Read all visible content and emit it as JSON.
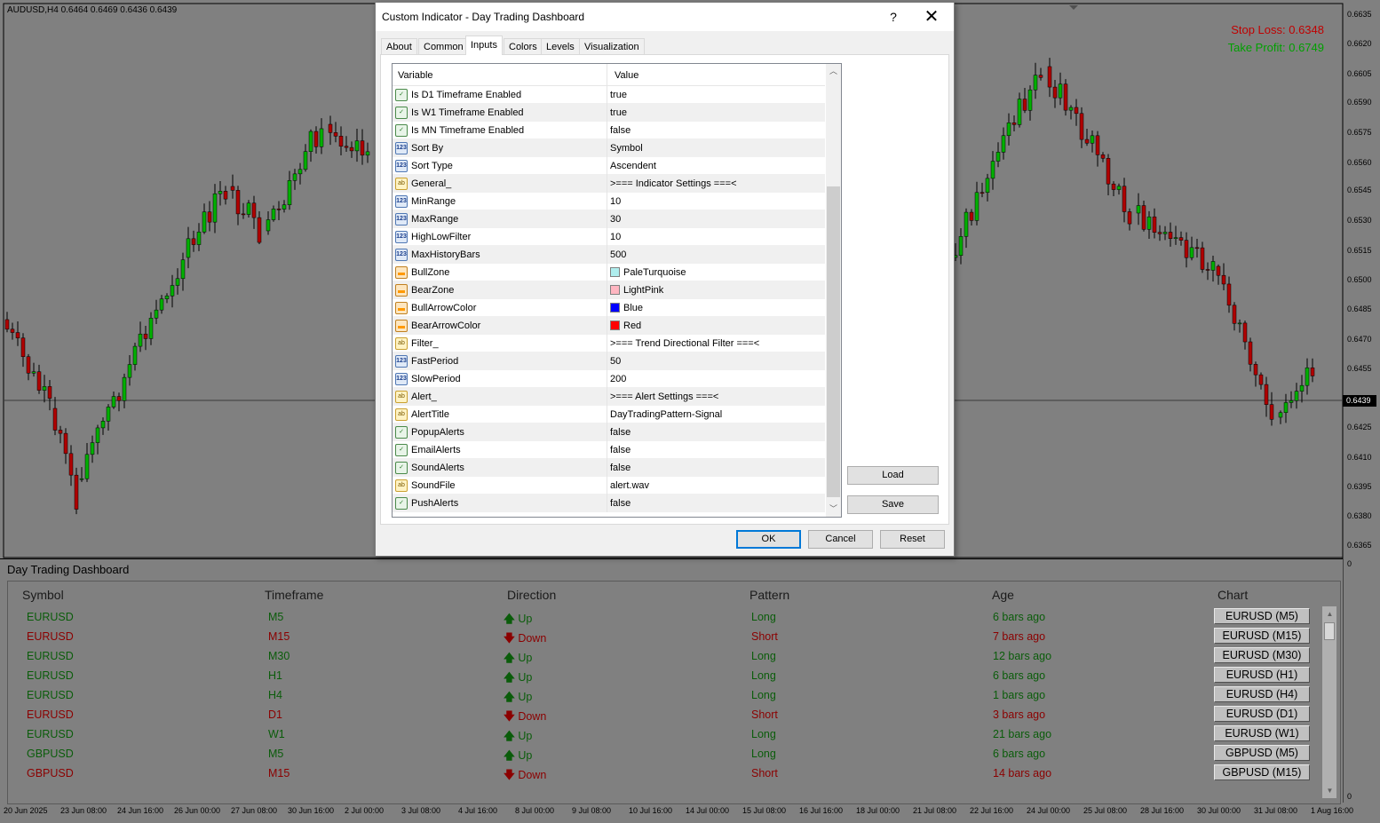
{
  "chart": {
    "symbol_header": "AUDUSD,H4  0.6464 0.6469 0.6436 0.6439",
    "stop_loss": "Stop Loss: 0.6348",
    "take_profit": "Take Profit: 0.6749",
    "current_price": "0.6439",
    "price_axis": [
      "0.6635",
      "0.6620",
      "0.6605",
      "0.6590",
      "0.6575",
      "0.6560",
      "0.6545",
      "0.6530",
      "0.6515",
      "0.6500",
      "0.6485",
      "0.6470",
      "0.6455",
      "0.6425",
      "0.6410",
      "0.6395",
      "0.6380",
      "0.6365",
      "0",
      "0"
    ],
    "time_axis": [
      "20 Jun 2025",
      "23 Jun 08:00",
      "24 Jun 16:00",
      "26 Jun 00:00",
      "27 Jun 08:00",
      "30 Jun 16:00",
      "2 Jul 00:00",
      "3 Jul 08:00",
      "4 Jul 16:00",
      "8 Jul 00:00",
      "9 Jul 08:00",
      "10 Jul 16:00",
      "14 Jul 00:00",
      "15 Jul 08:00",
      "16 Jul 16:00",
      "18 Jul 00:00",
      "21 Jul 08:00",
      "22 Jul 16:00",
      "24 Jul 00:00",
      "25 Jul 08:00",
      "28 Jul 16:00",
      "30 Jul 00:00",
      "31 Jul 08:00",
      "1 Aug 16:00"
    ],
    "colors": {
      "bull": "#00b000",
      "bear": "#b00000",
      "background": "#808080"
    }
  },
  "dialog": {
    "title": "Custom Indicator - Day Trading Dashboard",
    "help": "?",
    "close": "✕",
    "tabs": [
      "About",
      "Common",
      "Inputs",
      "Colors",
      "Levels",
      "Visualization"
    ],
    "active_tab": "Inputs",
    "grid_headers": {
      "variable": "Variable",
      "value": "Value"
    },
    "rows": [
      {
        "type": "bool",
        "var": "Is D1 Timeframe Enabled",
        "val": "true"
      },
      {
        "type": "bool",
        "var": "Is W1 Timeframe Enabled",
        "val": "true"
      },
      {
        "type": "bool",
        "var": "Is MN Timeframe Enabled",
        "val": "false"
      },
      {
        "type": "num",
        "var": "Sort By",
        "val": "Symbol"
      },
      {
        "type": "num",
        "var": "Sort Type",
        "val": "Ascendent"
      },
      {
        "type": "str",
        "var": "General_",
        "val": ">=== Indicator Settings ===<"
      },
      {
        "type": "num",
        "var": "MinRange",
        "val": "10"
      },
      {
        "type": "num",
        "var": "MaxRange",
        "val": "30"
      },
      {
        "type": "num",
        "var": "HighLowFilter",
        "val": "10"
      },
      {
        "type": "num",
        "var": "MaxHistoryBars",
        "val": "500"
      },
      {
        "type": "col",
        "var": "BullZone",
        "val": "PaleTurquoise",
        "swatch": "#afeeee"
      },
      {
        "type": "col",
        "var": "BearZone",
        "val": "LightPink",
        "swatch": "#ffb6c1"
      },
      {
        "type": "col",
        "var": "BullArrowColor",
        "val": "Blue",
        "swatch": "#0000ff"
      },
      {
        "type": "col",
        "var": "BearArrowColor",
        "val": "Red",
        "swatch": "#ff0000"
      },
      {
        "type": "str",
        "var": "Filter_",
        "val": ">=== Trend Directional Filter ===<"
      },
      {
        "type": "num",
        "var": "FastPeriod",
        "val": "50"
      },
      {
        "type": "num",
        "var": "SlowPeriod",
        "val": "200"
      },
      {
        "type": "str",
        "var": "Alert_",
        "val": ">=== Alert Settings ===<"
      },
      {
        "type": "str",
        "var": "AlertTitle",
        "val": "DayTradingPattern-Signal"
      },
      {
        "type": "bool",
        "var": "PopupAlerts",
        "val": "false"
      },
      {
        "type": "bool",
        "var": "EmailAlerts",
        "val": "false"
      },
      {
        "type": "bool",
        "var": "SoundAlerts",
        "val": "false"
      },
      {
        "type": "str",
        "var": "SoundFile",
        "val": "alert.wav"
      },
      {
        "type": "bool",
        "var": "PushAlerts",
        "val": "false"
      }
    ],
    "buttons": {
      "load": "Load",
      "save": "Save",
      "ok": "OK",
      "cancel": "Cancel",
      "reset": "Reset"
    }
  },
  "dashboard": {
    "title": "Day Trading Dashboard",
    "headers": [
      "Symbol",
      "Timeframe",
      "Direction",
      "Pattern",
      "Age",
      "Chart"
    ],
    "rows": [
      {
        "symbol": "EURUSD",
        "tf": "M5",
        "dir": "Up",
        "pattern": "Long",
        "age": "6 bars ago",
        "chart": "EURUSD (M5)"
      },
      {
        "symbol": "EURUSD",
        "tf": "M15",
        "dir": "Down",
        "pattern": "Short",
        "age": "7 bars ago",
        "chart": "EURUSD (M15)"
      },
      {
        "symbol": "EURUSD",
        "tf": "M30",
        "dir": "Up",
        "pattern": "Long",
        "age": "12 bars ago",
        "chart": "EURUSD (M30)"
      },
      {
        "symbol": "EURUSD",
        "tf": "H1",
        "dir": "Up",
        "pattern": "Long",
        "age": "6 bars ago",
        "chart": "EURUSD (H1)"
      },
      {
        "symbol": "EURUSD",
        "tf": "H4",
        "dir": "Up",
        "pattern": "Long",
        "age": "1 bars ago",
        "chart": "EURUSD (H4)"
      },
      {
        "symbol": "EURUSD",
        "tf": "D1",
        "dir": "Down",
        "pattern": "Short",
        "age": "3 bars ago",
        "chart": "EURUSD (D1)"
      },
      {
        "symbol": "EURUSD",
        "tf": "W1",
        "dir": "Up",
        "pattern": "Long",
        "age": "21 bars ago",
        "chart": "EURUSD (W1)"
      },
      {
        "symbol": "GBPUSD",
        "tf": "M5",
        "dir": "Up",
        "pattern": "Long",
        "age": "6 bars ago",
        "chart": "GBPUSD (M5)"
      },
      {
        "symbol": "GBPUSD",
        "tf": "M15",
        "dir": "Down",
        "pattern": "Short",
        "age": "14 bars ago",
        "chart": "GBPUSD (M15)"
      }
    ]
  }
}
